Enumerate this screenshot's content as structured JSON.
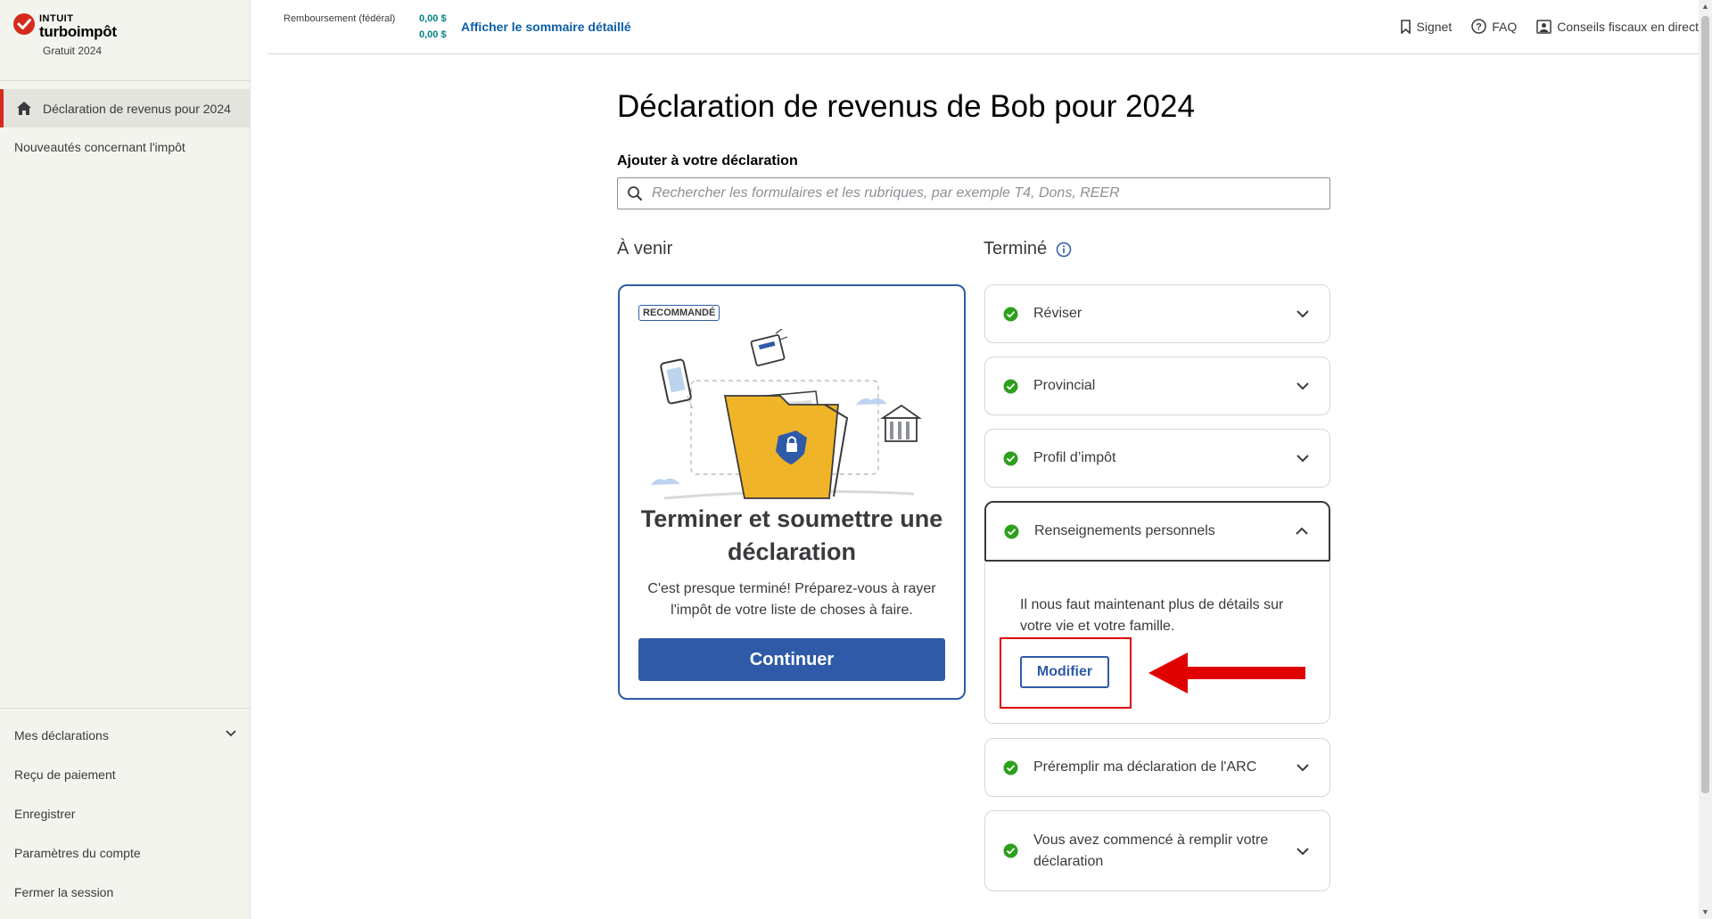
{
  "sidebar": {
    "brand_top": "INTUIT",
    "brand_main": "turboimpôt",
    "brand_sub": "Gratuit 2024",
    "active_item": "Déclaration de revenus pour 2024",
    "whats_new": "Nouveautés concernant l'impôt",
    "bottom_items": [
      "Mes déclarations",
      "Reçu de paiement",
      "Enregistrer",
      "Paramètres du compte",
      "Fermer la session"
    ]
  },
  "topbar": {
    "refund_label": "Remboursement (fédéral)",
    "refund_values": [
      "0,00 $",
      "0,00 $"
    ],
    "summary_link": "Afficher le sommaire détaillé",
    "links": [
      "Signet",
      "FAQ",
      "Conseils fiscaux en direct"
    ]
  },
  "main": {
    "title": "Déclaration de revenus de Bob pour 2024",
    "add_label": "Ajouter à votre déclaration",
    "search_placeholder": "Rechercher les formulaires et les rubriques, par exemple T4, Dons, REER",
    "upcoming_heading": "À venir",
    "done_heading": "Terminé"
  },
  "recommended": {
    "badge": "RECOMMANDÉ",
    "title": "Terminer et soumettre une déclaration",
    "text": "C'est presque terminé! Préparez-vous à rayer l'impôt de votre liste de choses à faire.",
    "button": "Continuer"
  },
  "completed": {
    "items": [
      "Réviser",
      "Provincial",
      "Profil d’impôt",
      "Renseignements personnels",
      "Préremplir ma déclaration de l'ARC",
      "Vous avez commencé à remplir votre déclaration"
    ],
    "open_body": "Il nous faut maintenant plus de détails sur votre vie et votre famille.",
    "open_button": "Modifier"
  },
  "colors": {
    "accent": "#2e5aa8",
    "brand_red": "#d52b1e",
    "check_green": "#2ca01c",
    "annotation_red": "#e00000"
  }
}
